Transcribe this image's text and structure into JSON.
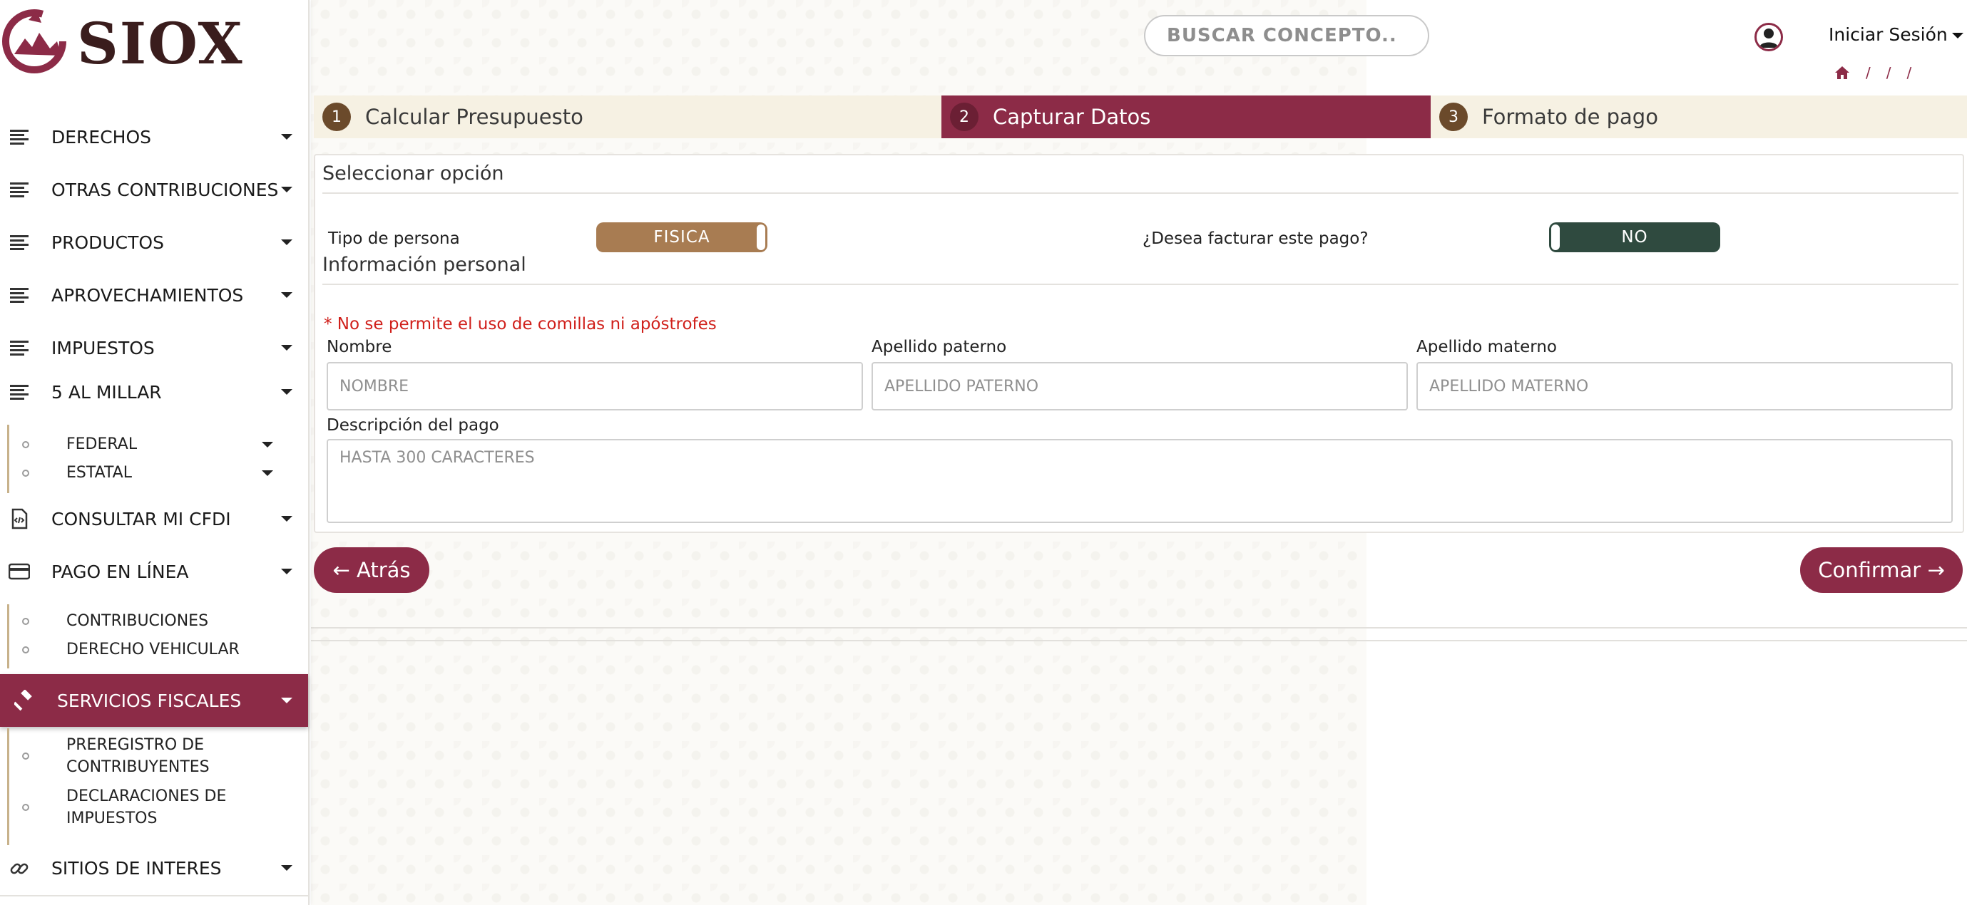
{
  "brand": {
    "name": "SIOX"
  },
  "sidebar": {
    "items": [
      {
        "label": "DERECHOS",
        "icon": "list-icon"
      },
      {
        "label": "OTRAS CONTRIBUCIONES",
        "icon": "list-icon"
      },
      {
        "label": "PRODUCTOS",
        "icon": "list-icon"
      },
      {
        "label": "APROVECHAMIENTOS",
        "icon": "list-icon"
      },
      {
        "label": "IMPUESTOS",
        "icon": "list-icon"
      },
      {
        "label": "5 AL MILLAR",
        "icon": "list-icon"
      },
      {
        "label": "CONSULTAR MI CFDI",
        "icon": "cfdi-document-icon"
      },
      {
        "label": "PAGO EN LÍNEA",
        "icon": "credit-card-icon"
      },
      {
        "label": "SERVICIOS FISCALES",
        "icon": "gavel-icon"
      },
      {
        "label": "SITIOS DE INTERES",
        "icon": "link-icon"
      }
    ],
    "millar_sub": [
      {
        "label": "FEDERAL"
      },
      {
        "label": "ESTATAL"
      }
    ],
    "pago_sub": [
      {
        "label": "CONTRIBUCIONES"
      },
      {
        "label": "DERECHO VEHICULAR"
      }
    ],
    "servicios_sub": [
      {
        "line1": "PREREGISTRO DE",
        "line2": "CONTRIBUYENTES"
      },
      {
        "line1": "DECLARACIONES DE",
        "line2": "IMPUESTOS"
      }
    ]
  },
  "header": {
    "search_placeholder": "BUSCAR CONCEPTO..",
    "login_label": "Iniciar Sesión",
    "breadcrumb": [
      "/",
      "/",
      "/"
    ]
  },
  "stepper": {
    "steps": [
      {
        "num": "1",
        "label": "Calcular Presupuesto"
      },
      {
        "num": "2",
        "label": "Capturar Datos"
      },
      {
        "num": "3",
        "label": "Formato de pago"
      }
    ],
    "active_index": 1
  },
  "form": {
    "select_title": "Seleccionar opción",
    "person_type_label": "Tipo de persona",
    "person_type_value": "FISICA",
    "invoice_label": "¿Desea facturar este pago?",
    "invoice_value": "NO",
    "personal_title": "Información personal",
    "warning": "* No se permite el uso de comillas ni apóstrofes",
    "nombre_label": "Nombre",
    "nombre_placeholder": "NOMBRE",
    "paterno_label": "Apellido paterno",
    "paterno_placeholder": "APELLIDO PATERNO",
    "materno_label": "Apellido materno",
    "materno_placeholder": "APELLIDO MATERNO",
    "descripcion_label": "Descripción del pago",
    "descripcion_placeholder": "HASTA 300 CARACTERES"
  },
  "actions": {
    "back_label": "← Atrás",
    "confirm_label": "Confirmar →"
  },
  "colors": {
    "accent": "#8c2b47",
    "toggle_fisica": "#a87c52",
    "toggle_no": "#2f4a3f",
    "warning": "#d0201b"
  }
}
